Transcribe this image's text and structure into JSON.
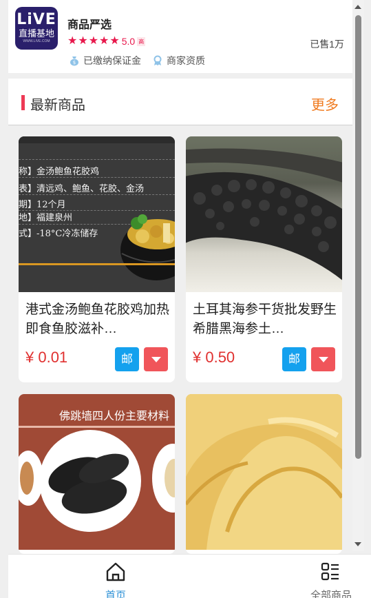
{
  "shop": {
    "logo": {
      "line1": "LiVE",
      "line2": "直播基地",
      "line3": "WWW.LIVE.COM"
    },
    "name": "商品严选",
    "rating": "5.0",
    "rating_badge": "高",
    "stars": 5,
    "sold": "已售1万",
    "certs": [
      {
        "label": "已缴纳保证金",
        "icon": "money-bag-icon"
      },
      {
        "label": "商家资质",
        "icon": "certificate-icon"
      }
    ]
  },
  "section": {
    "title": "最新商品",
    "more": "更多"
  },
  "products": [
    {
      "name": "港式金汤鲍鱼花胶鸡加热即食鱼胶滋补…",
      "price": "¥ 0.01",
      "post_label": "邮",
      "image_lines": [
        "称】金汤鲍鱼花胶鸡",
        "表】清远鸡、鲍鱼、花胶、金汤",
        "期】12个月",
        "地】福建泉州",
        "式】-18°C冷冻储存"
      ]
    },
    {
      "name": "土耳其海参干货批发野生希腊黑海参土…",
      "price": "¥ 0.50",
      "post_label": "邮"
    },
    {
      "image_title": "佛跳墙四人份主要材料"
    },
    {}
  ],
  "tabbar": [
    {
      "label": "首页",
      "icon": "home-icon",
      "active": true
    },
    {
      "label": "全部商品",
      "icon": "grid-list-icon",
      "active": false
    }
  ],
  "colors": {
    "accent": "#ee3a55",
    "more": "#f07a1e",
    "price": "#e0302f",
    "post": "#14a1ee",
    "active_tab": "#2a8fd6"
  }
}
